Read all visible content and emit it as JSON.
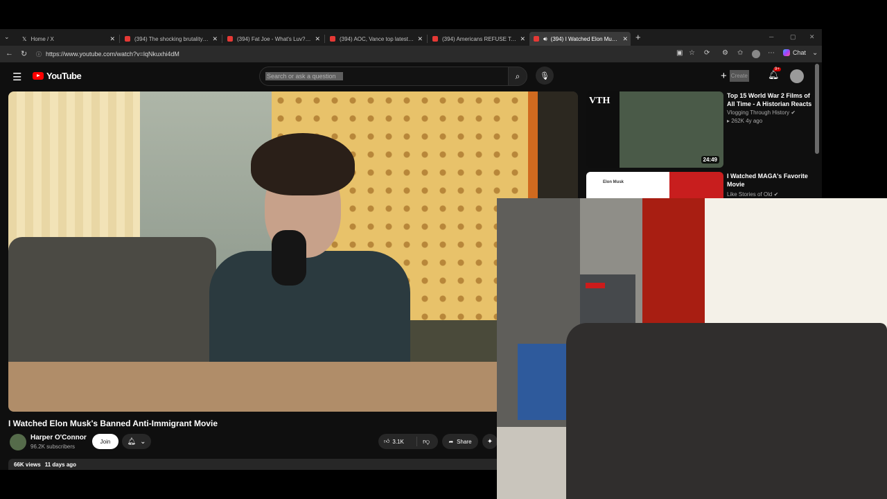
{
  "browser": {
    "tabs": [
      {
        "title": "Home / X",
        "type": "x"
      },
      {
        "title": "(394) The shocking brutality of th",
        "type": "yt"
      },
      {
        "title": "(394) Fat Joe - What's Luv? ft. Ash",
        "type": "yt"
      },
      {
        "title": "(394) AOC, Vance top latest 2028 ",
        "type": "yt"
      },
      {
        "title": "(394) Americans REFUSE To FORG",
        "type": "yt"
      },
      {
        "title": "(394) I Watched Elon Musk's B",
        "type": "yt",
        "active": true
      }
    ],
    "url": "https://www.youtube.com/watch?v=lqNkuxhi4dM",
    "chat_label": "Chat"
  },
  "youtube": {
    "logo_text": "YouTube",
    "search_placeholder": "Search or ask a question",
    "create_label": "Create",
    "notification_count": "9+"
  },
  "video": {
    "title": "I Watched Elon Musk's Banned Anti-Immigrant Movie",
    "channel": "Harper O'Connor",
    "subscribers": "96.2K subscribers",
    "join_label": "Join",
    "likes": "3.1K",
    "share_label": "Share",
    "views": "66K views",
    "age": "11 days ago"
  },
  "recommendations": [
    {
      "title": "Top 15 World War 2 Films of All Time - A Historian Reacts",
      "channel": "Vlogging Through History",
      "views": "262K",
      "age": "4y ago",
      "duration": "24:49",
      "thumb_text": "VTH"
    },
    {
      "title": "I Watched MAGA's Favorite Movie",
      "channel": "Like Stories of Old",
      "thumb_text": "Elon Musk"
    }
  ],
  "colors": {
    "youtube_red": "#ff0000",
    "background": "#0f0f0f"
  }
}
